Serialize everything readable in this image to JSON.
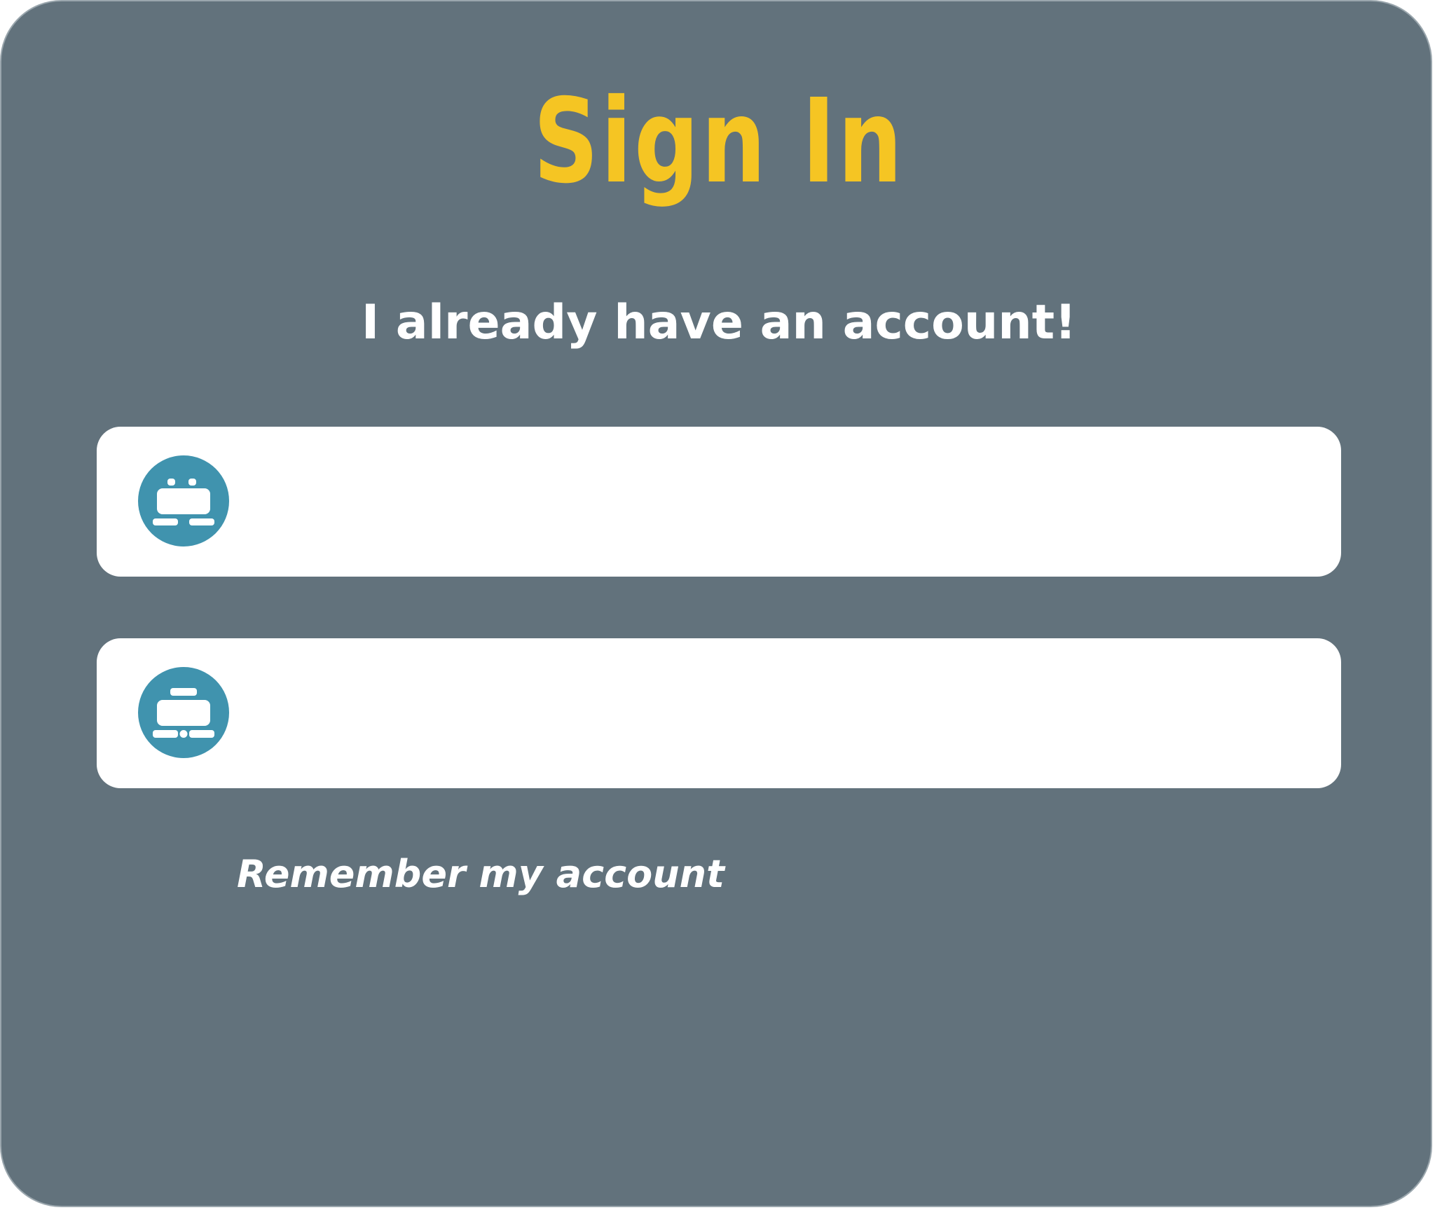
{
  "colors": {
    "card_background": "#62727c",
    "title": "#f5c523",
    "subtitle": "#ffffff",
    "field_background": "#ffffff",
    "icon_background": "#4093ae"
  },
  "header": {
    "title": "Sign In",
    "subtitle": "I already have an account!"
  },
  "form": {
    "username_field": {
      "icon": "user-id-icon",
      "value": "",
      "placeholder": ""
    },
    "password_field": {
      "icon": "password-key-icon",
      "value": "",
      "placeholder": ""
    },
    "remember_label": "Remember my account"
  }
}
